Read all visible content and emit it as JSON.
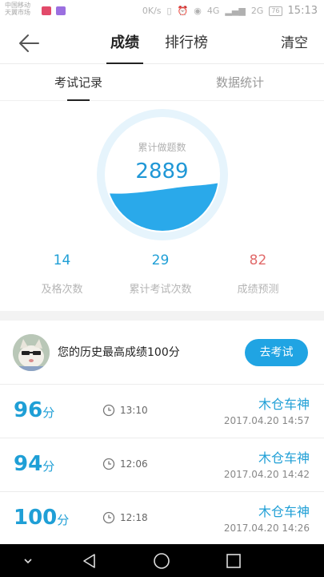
{
  "status_bar": {
    "carrier_line1": "中国移动",
    "carrier_line2": "天翼市场",
    "speed": "0K/s",
    "network": "4G",
    "network2": "2G",
    "battery": "76",
    "time": "15:13"
  },
  "header": {
    "tabs": [
      {
        "label": "成绩",
        "active": true
      },
      {
        "label": "排行榜",
        "active": false
      }
    ],
    "clear_label": "清空"
  },
  "sub_tabs": [
    {
      "label": "考试记录",
      "active": true
    },
    {
      "label": "数据统计",
      "active": false
    }
  ],
  "summary": {
    "total_label": "累计做题数",
    "total_value": "2889",
    "fill_fraction": 0.4,
    "stats": [
      {
        "value": "14",
        "label": "及格次数",
        "color": "#1f9fd6"
      },
      {
        "value": "29",
        "label": "累计考试次数",
        "color": "#1f9fd6"
      },
      {
        "value": "82",
        "label": "成绩预测",
        "color": "#e16a6a"
      }
    ]
  },
  "best": {
    "text": "您的历史最高成绩100分",
    "button_label": "去考试"
  },
  "records": [
    {
      "score": "96",
      "unit": "分",
      "duration": "13:10",
      "name": "木仓车神",
      "date": "2017.04.20  14:57"
    },
    {
      "score": "94",
      "unit": "分",
      "duration": "12:06",
      "name": "木仓车神",
      "date": "2017.04.20  14:42"
    },
    {
      "score": "100",
      "unit": "分",
      "duration": "12:18",
      "name": "木仓车神",
      "date": "2017.04.20  14:26"
    }
  ],
  "colors": {
    "accent": "#1f9fd6",
    "button": "#20a4e3",
    "prediction": "#e16a6a"
  }
}
